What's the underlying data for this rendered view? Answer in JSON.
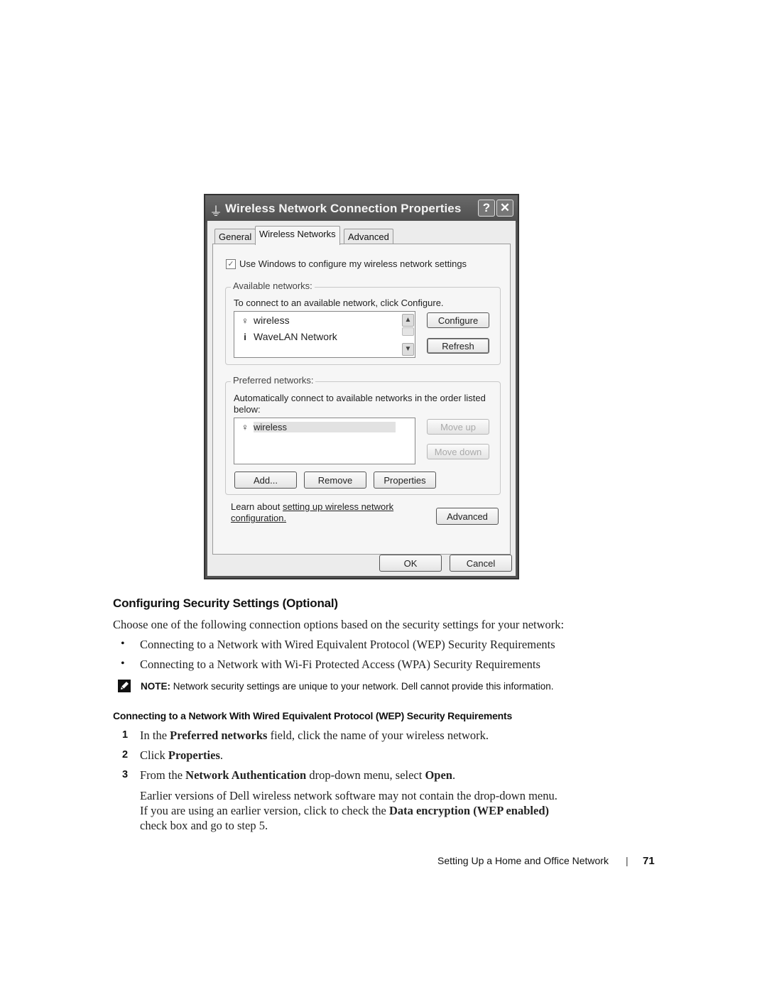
{
  "dialog": {
    "title": "Wireless Network Connection Properties",
    "title_icon": "network-connection-icon",
    "help_label": "?",
    "close_label": "✕",
    "tabs": [
      {
        "label": "General",
        "active": false
      },
      {
        "label": "Wireless Networks",
        "active": true
      },
      {
        "label": "Advanced",
        "active": false
      }
    ],
    "use_windows_checkbox": {
      "label": "Use Windows to configure my wireless network settings",
      "checked": true
    },
    "available": {
      "legend": "Available networks:",
      "instruction": "To connect to an available network, click Configure.",
      "networks": [
        {
          "name": "wireless",
          "icon": "antenna-icon"
        },
        {
          "name": "WaveLAN Network",
          "icon": "info-icon"
        }
      ],
      "configure_label": "Configure",
      "refresh_label": "Refresh"
    },
    "preferred": {
      "legend": "Preferred networks:",
      "instruction_line1": "Automatically connect to available networks in the order listed",
      "instruction_line2": "below:",
      "networks": [
        {
          "name": "wireless",
          "icon": "antenna-icon",
          "selected": true
        }
      ],
      "move_up_label": "Move up",
      "move_down_label": "Move down",
      "add_label": "Add...",
      "remove_label": "Remove",
      "properties_label": "Properties"
    },
    "learn_prefix": "Learn about ",
    "learn_link_line1": "setting up wireless network",
    "learn_link_line2": "configuration.",
    "advanced_label": "Advanced",
    "ok_label": "OK",
    "cancel_label": "Cancel"
  },
  "doc": {
    "heading": "Configuring Security Settings (Optional)",
    "intro": "Choose one of the following connection options based on the security settings for your network:",
    "bullets": [
      "Connecting to a Network with Wired Equivalent Protocol (WEP) Security Requirements",
      "Connecting to a Network with Wi-Fi Protected Access (WPA) Security Requirements"
    ],
    "bullet_char": "•",
    "note_label": "NOTE:",
    "note_text": " Network security settings are unique to your network. Dell cannot provide this information.",
    "subheading": "Connecting to a Network With Wired Equivalent Protocol (WEP) Security Requirements",
    "steps": [
      {
        "num": "1",
        "parts": [
          {
            "t": "In the ",
            "b": false
          },
          {
            "t": "Preferred networks",
            "b": true
          },
          {
            "t": " field, click the name of your wireless network.",
            "b": false
          }
        ]
      },
      {
        "num": "2",
        "parts": [
          {
            "t": "Click ",
            "b": false
          },
          {
            "t": "Properties",
            "b": true
          },
          {
            "t": ".",
            "b": false
          }
        ]
      },
      {
        "num": "3",
        "parts": [
          {
            "t": "From the ",
            "b": false
          },
          {
            "t": "Network Authentication",
            "b": true
          },
          {
            "t": " drop-down menu, select ",
            "b": false
          },
          {
            "t": "Open",
            "b": true
          },
          {
            "t": ".",
            "b": false
          }
        ]
      }
    ],
    "step3_note": {
      "line1": "Earlier versions of Dell wireless network software may not contain the drop-down menu.",
      "line2_prefix": "If you are using an earlier version, click to check the ",
      "line2_bold": "Data encryption (WEP enabled)",
      "line3": "check box and go to step 5."
    }
  },
  "footer": {
    "section": "Setting Up a Home and Office Network",
    "separator": "|",
    "page": "71"
  }
}
